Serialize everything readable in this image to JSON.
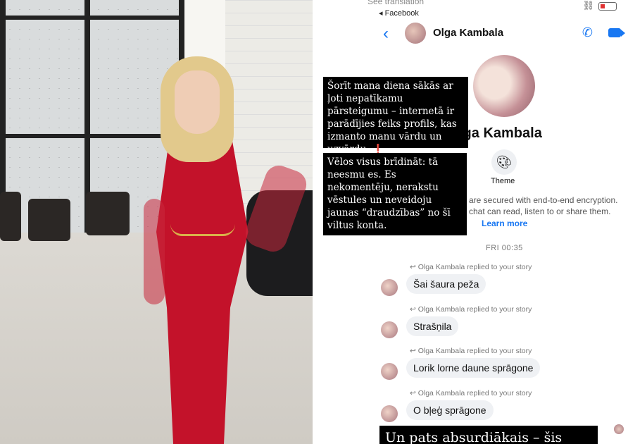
{
  "status_bar": {
    "see_translation": "See translation",
    "back_app": "◂ Facebook"
  },
  "header": {
    "contact_name": "Olga Kambala"
  },
  "profile": {
    "name": "lga Kambala",
    "theme_label": "Theme",
    "encryption_line1": "are secured with end-to-end encryption.",
    "encryption_line2": "chat can read, listen to or share them.",
    "learn_more": "Learn more"
  },
  "timestamp": "FRI 00:35",
  "overlay_notes": {
    "note1": "Šorīt mana diena sākās ar ļoti nepatīkamu pārsteigumu – internetā ir parādījies feiks profils, kas izmanto manu vārdu un uzvārdu.",
    "note1_mark": "❗",
    "note2": "Vēlos visus brīdināt: tā neesmu es. Es nekomentēju, nerakstu vēstules un neveidoju jaunas “draudzības” no šī viltus konta."
  },
  "messages": [
    {
      "replied": "Olga Kambala replied to your story",
      "text": "Šai šaura peža"
    },
    {
      "replied": "Olga Kambala replied to your story",
      "text": "Strašņila"
    },
    {
      "replied": "Olga Kambala replied to your story",
      "text": "Lorik lorne daune sprāgone"
    },
    {
      "replied": "Olga Kambala replied to your story",
      "text": "O bļeģ sprāgone"
    }
  ],
  "bottom_banner": "Un pats absurdiākais – šis",
  "colors": {
    "accent": "#1877f2",
    "dress": "#c3122a",
    "overlay": "#000000"
  },
  "icons": [
    "back-arrow-icon",
    "phone-icon",
    "video-call-icon",
    "palette-icon",
    "reply-arrow-icon",
    "link-icon",
    "battery-icon"
  ]
}
